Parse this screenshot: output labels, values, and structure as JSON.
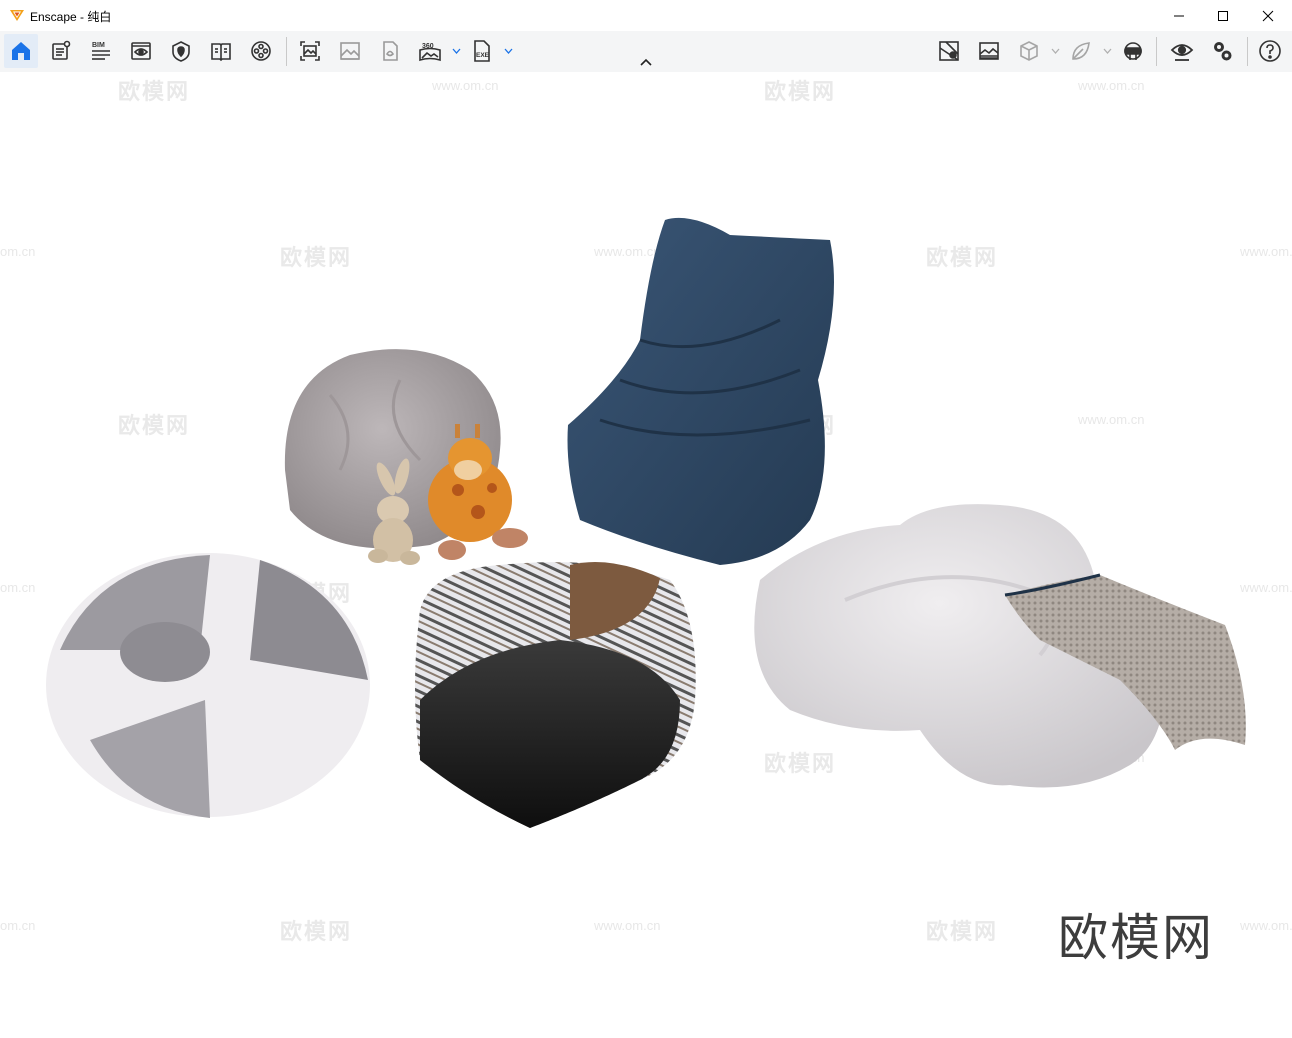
{
  "window": {
    "app_name": "Enscape",
    "title": "Enscape - 纯白",
    "controls": [
      "minimize-icon",
      "maximize-icon",
      "close-icon"
    ]
  },
  "toolbar": {
    "left_tools": [
      {
        "name": "home",
        "icon": "home-icon",
        "active": true
      },
      {
        "name": "views",
        "icon": "document-list-icon"
      },
      {
        "name": "bim",
        "icon": "bim-icon",
        "label": "BIM"
      },
      {
        "name": "view-manager",
        "icon": "eye-window-icon"
      },
      {
        "name": "sites",
        "icon": "map-shield-icon"
      },
      {
        "name": "book",
        "icon": "book-icon"
      },
      {
        "name": "video",
        "icon": "film-reel-icon"
      }
    ],
    "capture_tools": [
      {
        "name": "screenshot",
        "icon": "screenshot-icon"
      },
      {
        "name": "image",
        "icon": "image-icon"
      },
      {
        "name": "asset",
        "icon": "asset-icon"
      },
      {
        "name": "panorama",
        "icon": "panorama-icon",
        "label": "360"
      },
      {
        "name": "export",
        "icon": "exe-export-icon",
        "label": "EXE"
      }
    ],
    "right_tools": [
      {
        "name": "map",
        "icon": "map-pin-icon"
      },
      {
        "name": "atmosphere",
        "icon": "atmosphere-icon"
      },
      {
        "name": "cube",
        "icon": "cube-icon"
      },
      {
        "name": "leaf",
        "icon": "leaf-icon"
      },
      {
        "name": "vr",
        "icon": "vr-headset-icon"
      },
      {
        "name": "visual-settings",
        "icon": "eye-settings-icon"
      },
      {
        "name": "settings",
        "icon": "gears-icon"
      },
      {
        "name": "help",
        "icon": "help-icon"
      }
    ]
  },
  "viewport": {
    "watermark_text": "欧模网",
    "watermark_url": "www.om.cn",
    "watermark_url_partial": "om.cn",
    "watermark_big": "欧模网",
    "scene_objects": [
      "grey-beanbag-ball",
      "plush-rabbit",
      "plush-giraffe",
      "blue-beanbag-chair",
      "grey-white-beanbag",
      "patterned-pouf",
      "white-cloud-floor-cushion",
      "knit-throw-blanket"
    ]
  },
  "colors": {
    "accent": "#1a73e8",
    "blue_chair": "#2f4660",
    "grey_beanbag": "#a9a2a4",
    "cloud_cushion": "#e4e2e4"
  }
}
